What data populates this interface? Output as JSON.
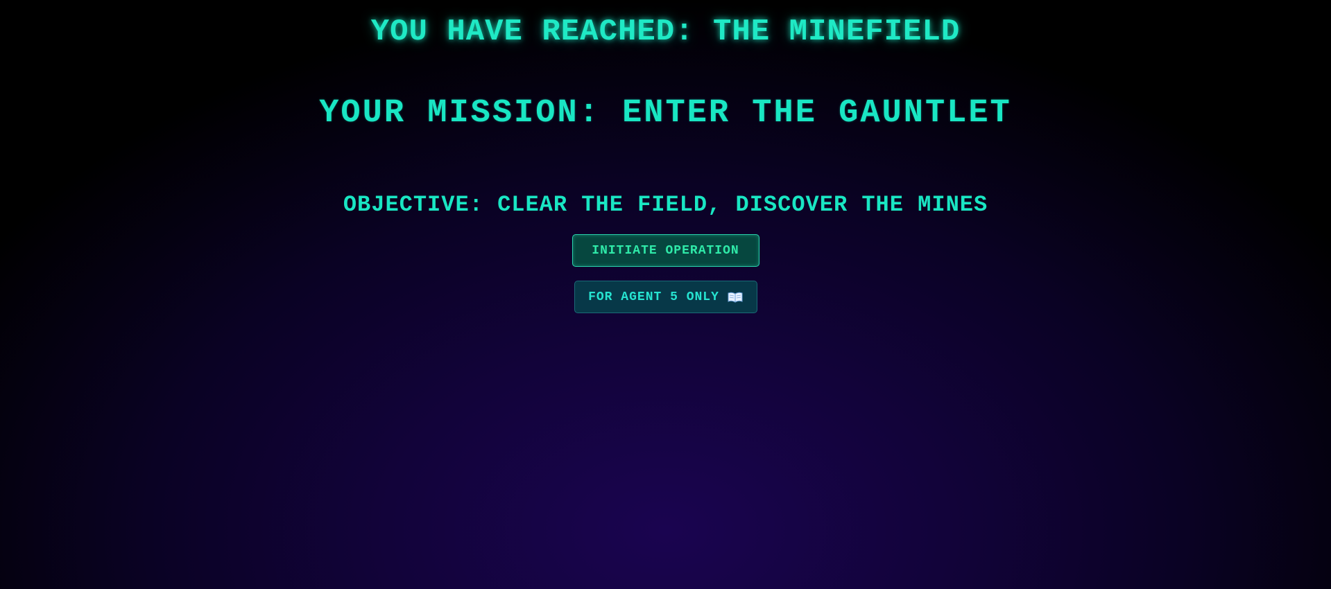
{
  "header": {
    "headline": "YOU HAVE REACHED: THE MINEFIELD",
    "mission": "YOUR MISSION: ENTER THE GAUNTLET",
    "objective": "OBJECTIVE: CLEAR THE FIELD, DISCOVER THE MINES"
  },
  "actions": {
    "start_label": "INITIATE OPERATION",
    "manual_label": "FOR AGENT 5 ONLY",
    "manual_icon": "open-book-icon"
  },
  "colors": {
    "accent": "#19e6c3",
    "primary_button_bg": "#06473f",
    "secondary_button_bg": "#073848",
    "background_center": "#1a0450",
    "background_edge": "#000000"
  }
}
